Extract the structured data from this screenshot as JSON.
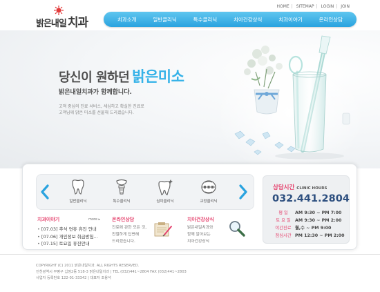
{
  "logo": {
    "text_small": "밝은내일",
    "text_large": "치과"
  },
  "util_links": [
    "HOME",
    "SITEMAP",
    "LOGIN",
    "JOIN"
  ],
  "gnb": [
    "치과소개",
    "일반클리닉",
    "특수클리닉",
    "치아건강상식",
    "치과이야기",
    "온라인상담"
  ],
  "hero": {
    "title": "당신이 원하던",
    "title_accent": "밝은미소",
    "subtitle": "밝은내일치과가 함께합니다.",
    "body_line1": "고객 중심의 진료 서비스, 세심하고 확실한 진료로",
    "body_line2": "고객님께 밝은 미소를 선물해 드리겠습니다."
  },
  "services": [
    "일반클리닉",
    "특수클리닉",
    "심미클리닉",
    "교정클리닉"
  ],
  "news": {
    "title": "치과이야기",
    "more": "more ▸",
    "items": [
      "[07.03] 추석 연휴 휴진 안내",
      "[07.06] 개인정보 취급방침...",
      "[07.15] 토요일 휴진안내"
    ]
  },
  "consult": {
    "title": "온라인상담",
    "lines": [
      "진료에 관한 모든 것,",
      "친절하게 답변해",
      "드리겠습니다."
    ]
  },
  "knowledge": {
    "title": "치아건강상식",
    "lines": [
      "밝은내일치과와",
      "함께 알아보는",
      "치아건강상식"
    ]
  },
  "hours": {
    "title": "상담시간",
    "title_en": "CLINIC HOURS",
    "phone": "032.441.2804",
    "rows": [
      {
        "day": "평  일",
        "time": "AM 9:30 ~ PM 7:00"
      },
      {
        "day": "토 요 일",
        "time": "AM 9:30 ~ PM 2:00"
      },
      {
        "day": "야간진료",
        "time": "월,수  ~ PM 9:00"
      },
      {
        "day": "점심시간",
        "time": "PM 12:30 ~ PM 2:00"
      }
    ]
  },
  "footer": {
    "line1": "COPYRIGHT (C) 2011 밝은내일치과. ALL RIGHTS RESERVED.",
    "line2": "인천광역시 부평구 십정2동 518-3 밝은내일치과  |  TEL (032)441~2804    FAX (032)441~2803",
    "line3": "사업자 등록번호 122-01-33342  |  대표자 조용석"
  }
}
